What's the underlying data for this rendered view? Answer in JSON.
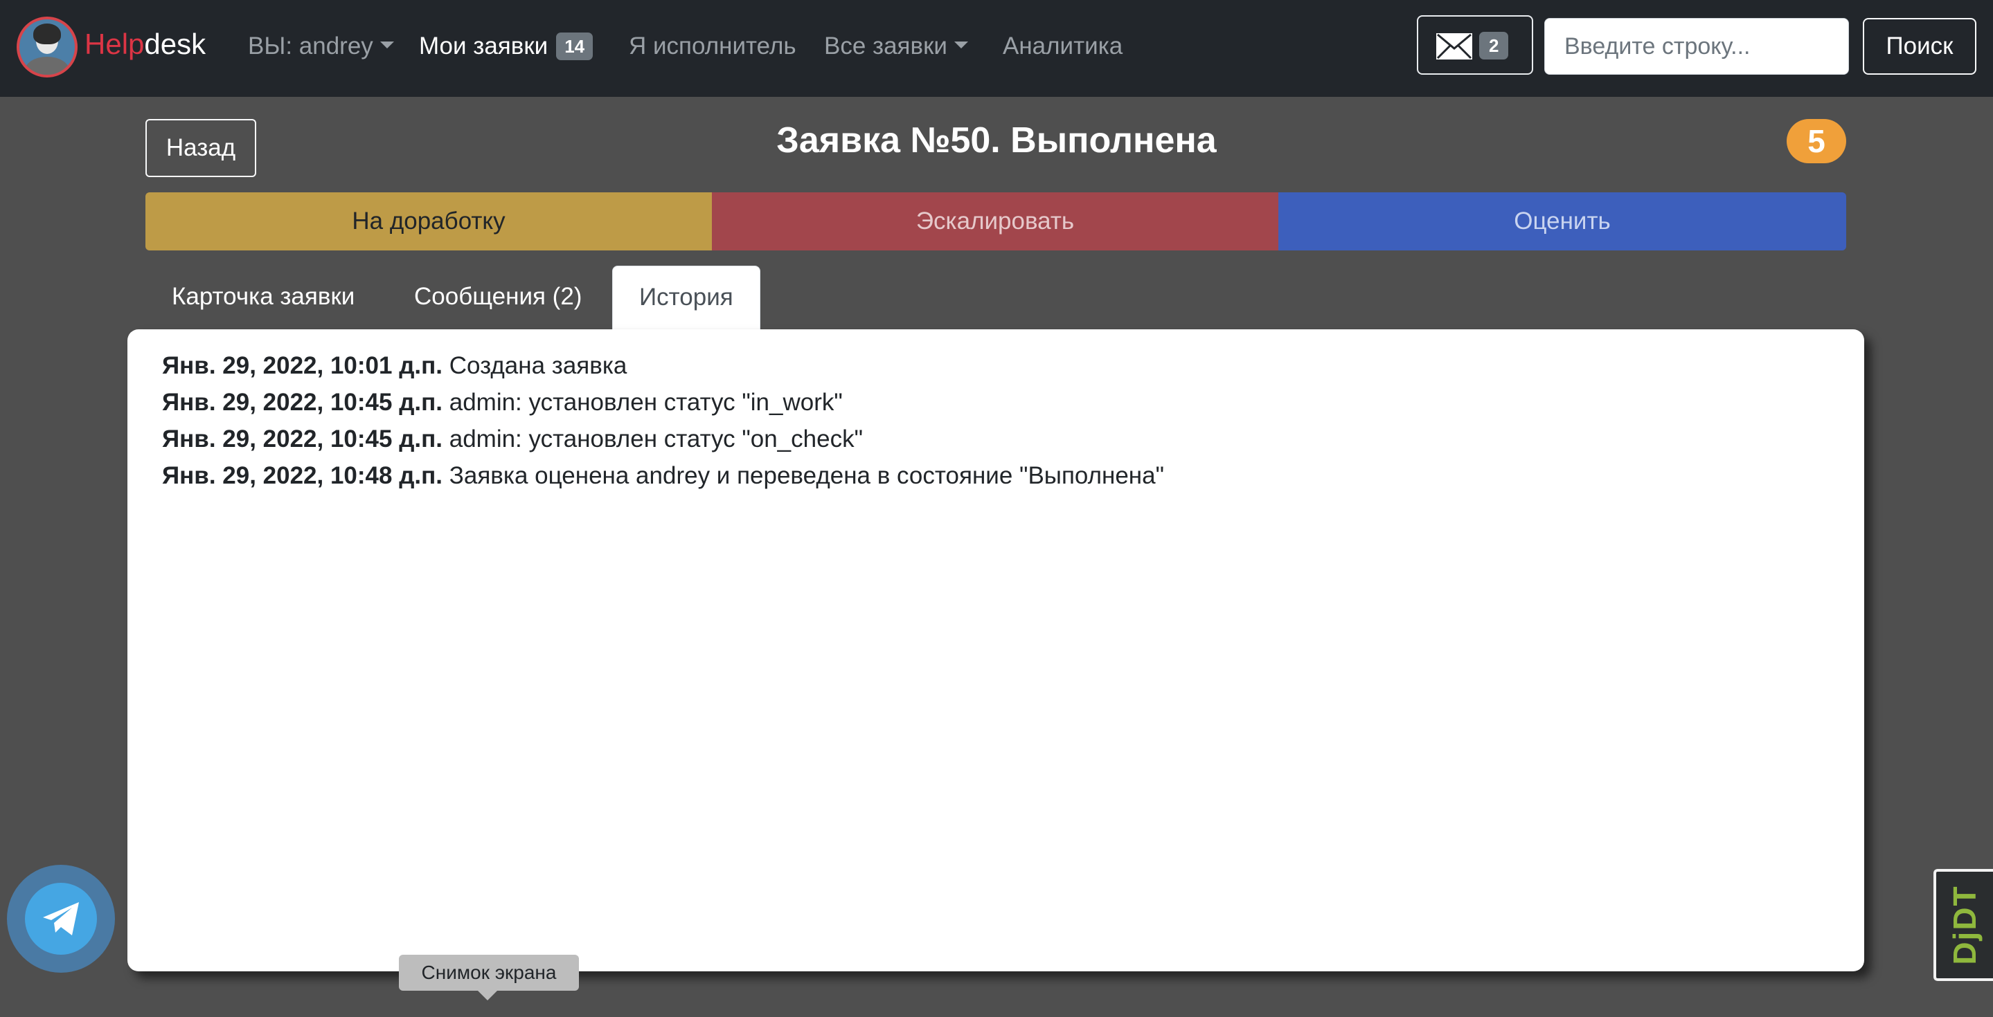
{
  "navbar": {
    "brand_part1": "Help",
    "brand_part2": "desk",
    "user_menu": "ВЫ: andrey",
    "my_tickets": "Мои заявки",
    "my_tickets_count": "14",
    "i_am_assignee": "Я исполнитель",
    "all_tickets": "Все заявки",
    "analytics": "Аналитика",
    "mail_count": "2",
    "search_placeholder": "Введите строку...",
    "search_button": "Поиск"
  },
  "header": {
    "back_button": "Назад",
    "title": "Заявка №50. Выполнена",
    "rating": "5"
  },
  "actions": {
    "rework": "На доработку",
    "escalate": "Эскалировать",
    "rate": "Оценить"
  },
  "tabs": [
    {
      "label": "Карточка заявки",
      "active": false
    },
    {
      "label": "Сообщения (2)",
      "active": false
    },
    {
      "label": "История",
      "active": true
    }
  ],
  "history": [
    {
      "timestamp": "Янв. 29, 2022, 10:01 д.п.",
      "text": "Создана заявка"
    },
    {
      "timestamp": "Янв. 29, 2022, 10:45 д.п.",
      "text": "admin: установлен статус \"in_work\""
    },
    {
      "timestamp": "Янв. 29, 2022, 10:45 д.п.",
      "text": "admin: установлен статус \"on_check\""
    },
    {
      "timestamp": "Янв. 29, 2022, 10:48 д.п.",
      "text": "Заявка оценена andrey и переведена в состояние \"Выполнена\""
    }
  ],
  "tooltip": "Снимок экрана",
  "debug_toolbar": "DjDT",
  "colors": {
    "navbar_bg": "#22262b",
    "page_bg": "#4f4f4f",
    "brand_red": "#dc3545",
    "rework": "#be9b47",
    "escalate": "#a2464c",
    "rate": "#3d5fbc",
    "rating_badge": "#f0a03a"
  }
}
